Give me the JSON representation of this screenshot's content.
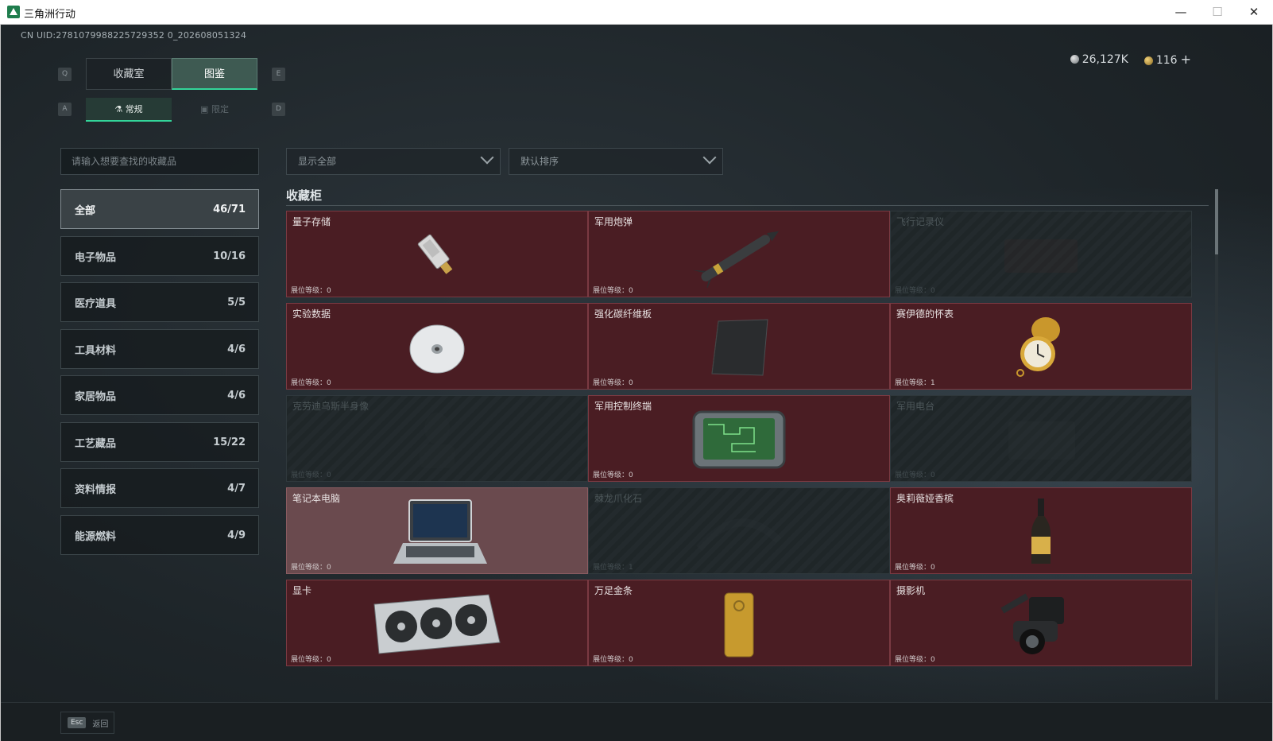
{
  "window": {
    "title": "三角洲行动",
    "minimize_glyph": "—",
    "maximize_glyph": "☐",
    "close_glyph": "✕"
  },
  "header": {
    "uid": "CN UID:2781079988225729352 0_202608051324",
    "currency": {
      "silver": "26,127K",
      "gold": "116",
      "plus": "+"
    }
  },
  "tabs": {
    "hint_left": "Q",
    "hint_right": "E",
    "items": [
      {
        "label": "收藏室",
        "active": false
      },
      {
        "label": "图鉴",
        "active": true
      }
    ]
  },
  "subtabs": {
    "hint_left": "A",
    "hint_right": "D",
    "items": [
      {
        "label": "常规",
        "active": true
      },
      {
        "label": "限定",
        "active": false
      }
    ]
  },
  "search": {
    "placeholder": "请输入想要查找的收藏品"
  },
  "filters": {
    "show": "显示全部",
    "sort": "默认排序"
  },
  "categories": [
    {
      "label": "全部",
      "count": "46/71",
      "active": true
    },
    {
      "label": "电子物品",
      "count": "10/16",
      "active": false
    },
    {
      "label": "医疗道具",
      "count": "5/5",
      "active": false
    },
    {
      "label": "工具材料",
      "count": "4/6",
      "active": false
    },
    {
      "label": "家居物品",
      "count": "4/6",
      "active": false
    },
    {
      "label": "工艺藏品",
      "count": "15/22",
      "active": false
    },
    {
      "label": "资料情报",
      "count": "4/7",
      "active": false
    },
    {
      "label": "能源燃料",
      "count": "4/9",
      "active": false
    }
  ],
  "section_title": "收藏柜",
  "level_label": "展位等级：",
  "items": [
    {
      "name": "量子存储",
      "level": "0",
      "state": "owned",
      "icon": "usb-drive-icon"
    },
    {
      "name": "军用炮弹",
      "level": "0",
      "state": "owned",
      "icon": "missile-icon"
    },
    {
      "name": "飞行记录仪",
      "level": "0",
      "state": "locked",
      "icon": "flight-recorder-icon"
    },
    {
      "name": "实验数据",
      "level": "0",
      "state": "owned",
      "icon": "disc-icon"
    },
    {
      "name": "强化碳纤维板",
      "level": "0",
      "state": "owned",
      "icon": "carbon-plate-icon"
    },
    {
      "name": "赛伊德的怀表",
      "level": "1",
      "state": "owned",
      "icon": "pocket-watch-icon"
    },
    {
      "name": "克劳迪乌斯半身像",
      "level": "0",
      "state": "locked",
      "icon": "bust-icon"
    },
    {
      "name": "军用控制终端",
      "level": "0",
      "state": "owned",
      "icon": "control-terminal-icon"
    },
    {
      "name": "军用电台",
      "level": "0",
      "state": "locked",
      "icon": "radio-icon"
    },
    {
      "name": "笔记本电脑",
      "level": "0",
      "state": "highlight",
      "icon": "laptop-icon"
    },
    {
      "name": "棘龙爪化石",
      "level": "1",
      "state": "locked",
      "icon": "fossil-icon"
    },
    {
      "name": "奥莉薇娅香槟",
      "level": "0",
      "state": "owned",
      "icon": "champagne-icon"
    },
    {
      "name": "显卡",
      "level": "0",
      "state": "owned",
      "icon": "graphics-card-icon"
    },
    {
      "name": "万足金条",
      "level": "0",
      "state": "owned",
      "icon": "gold-bar-icon"
    },
    {
      "name": "摄影机",
      "level": "0",
      "state": "owned",
      "icon": "camera-icon"
    }
  ],
  "footer": {
    "esc_key": "Esc",
    "back_label": "返回"
  }
}
